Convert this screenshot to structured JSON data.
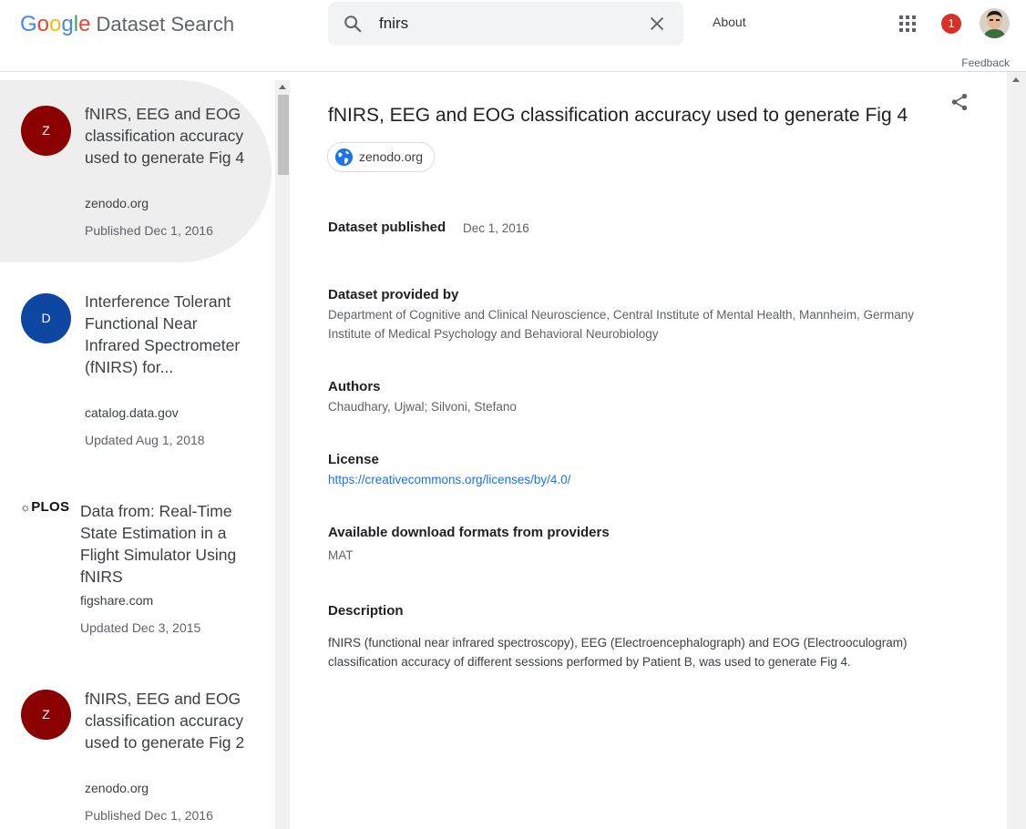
{
  "header": {
    "logo_parts": [
      "G",
      "o",
      "o",
      "g",
      "l",
      "e"
    ],
    "product": "Dataset Search",
    "search_value": "fnirs",
    "about": "About",
    "notification_count": "1",
    "feedback": "Feedback"
  },
  "results": [
    {
      "badge": "Z",
      "badge_color": "#8b0000",
      "title": "fNIRS, EEG and EOG classification accuracy used to generate Fig 4",
      "source": "zenodo.org",
      "date": "Published Dec 1, 2016",
      "selected": true
    },
    {
      "badge": "D",
      "badge_color": "#0d47a1",
      "title": "Interference Tolerant Functional Near Infrared Spectrometer (fNIRS) for...",
      "source": "catalog.data.gov",
      "date": "Updated Aug 1, 2018",
      "selected": false
    },
    {
      "badge": "PLOS",
      "badge_color": "#111111",
      "title": "Data from: Real-Time State Estimation in a Flight Simulator Using fNIRS",
      "source": "figshare.com",
      "date": "Updated Dec 3, 2015",
      "selected": false
    },
    {
      "badge": "Z",
      "badge_color": "#8b0000",
      "title": "fNIRS, EEG and EOG classification accuracy used to generate Fig 2",
      "source": "zenodo.org",
      "date": "Published Dec 1, 2016",
      "selected": false
    }
  ],
  "detail": {
    "title": "fNIRS, EEG and EOG classification accuracy used to generate Fig 4",
    "source_chip": "zenodo.org",
    "published_label": "Dataset published",
    "published_value": "Dec 1, 2016",
    "provided_label": "Dataset provided by",
    "provided_lines": [
      "Department of Cognitive and Clinical Neuroscience, Central Institute of Mental Health, Mannheim, Germany",
      "Institute of Medical Psychology and Behavioral Neurobiology"
    ],
    "authors_label": "Authors",
    "authors_value": "Chaudhary, Ujwal; Silvoni, Stefano",
    "license_label": "License",
    "license_value": "https://creativecommons.org/licenses/by/4.0/",
    "formats_label": "Available download formats from providers",
    "formats_value": "MAT",
    "description_label": "Description",
    "description_value": "fNIRS (functional near infrared spectroscopy), EEG (Electroencephalograph) and EOG (Electrooculogram) classification accuracy of different sessions performed by Patient B, was used to generate Fig 4."
  },
  "colors": {
    "accent": "#1a73e8",
    "notification": "#d93025"
  },
  "icons": [
    "search-icon",
    "clear-icon",
    "apps-grid-icon",
    "share-icon",
    "globe-icon",
    "plos-logo-icon"
  ]
}
